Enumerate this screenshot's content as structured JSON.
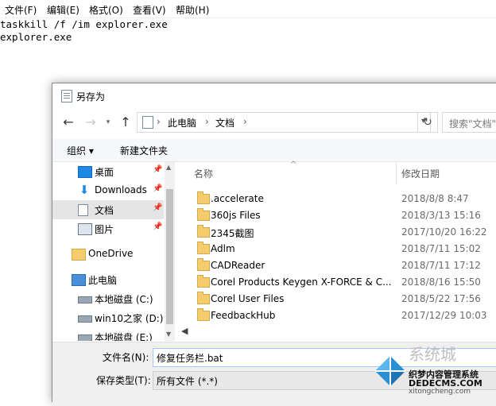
{
  "notepad": {
    "menu": [
      "文件(F)",
      "编辑(E)",
      "格式(O)",
      "查看(V)",
      "帮助(H)"
    ],
    "lines": [
      "taskkill /f /im explorer.exe",
      "explorer.exe"
    ]
  },
  "dialog": {
    "title": "另存为",
    "address": {
      "crumbs": [
        "此电脑",
        "文档"
      ]
    },
    "search_placeholder": "搜索\"文档\"",
    "toolbar": {
      "organize": "组织 ▾",
      "new_folder": "新建文件夹"
    },
    "nav": [
      {
        "label": "桌面",
        "icon": "desktop-icon",
        "pinned": true
      },
      {
        "label": "Downloads",
        "icon": "download-icon",
        "pinned": true
      },
      {
        "label": "文档",
        "icon": "document-icon",
        "pinned": true,
        "selected": true
      },
      {
        "label": "图片",
        "icon": "pictures-icon",
        "pinned": true
      },
      {
        "label": "OneDrive",
        "icon": "folder-icon"
      },
      {
        "label": "此电脑",
        "icon": "computer-icon"
      },
      {
        "label": "本地磁盘 (C:)",
        "icon": "drive-icon"
      },
      {
        "label": "win10之家 (D:)",
        "icon": "drive-icon"
      },
      {
        "label": "本地磁盘 (E:)",
        "icon": "drive-icon"
      }
    ],
    "columns": {
      "name": "名称",
      "date": "修改日期"
    },
    "files": [
      {
        "name": ".accelerate",
        "date": "2018/8/8 8:47"
      },
      {
        "name": "360js Files",
        "date": "2018/3/13 15:16"
      },
      {
        "name": "2345截图",
        "date": "2017/10/20 16:22"
      },
      {
        "name": "Adlm",
        "date": "2018/7/11 15:02"
      },
      {
        "name": "CADReader",
        "date": "2018/7/11 17:12"
      },
      {
        "name": "Corel Products Keygen X-FORCE & C...",
        "date": "2018/8/16 15:50"
      },
      {
        "name": "Corel User Files",
        "date": "2018/5/22 17:56"
      },
      {
        "name": "FeedbackHub",
        "date": "2017/12/29 10:03"
      }
    ],
    "filename_label": "文件名(N):",
    "filename_value": "修复任务栏.bat",
    "filetype_label": "保存类型(T):",
    "filetype_value": "所有文件 (*.*)"
  },
  "watermark": {
    "big": "系统城",
    "line1": "织梦内容管理系统",
    "line2": "DEDECMS.COM",
    "line3": "xitongcheng.com"
  }
}
